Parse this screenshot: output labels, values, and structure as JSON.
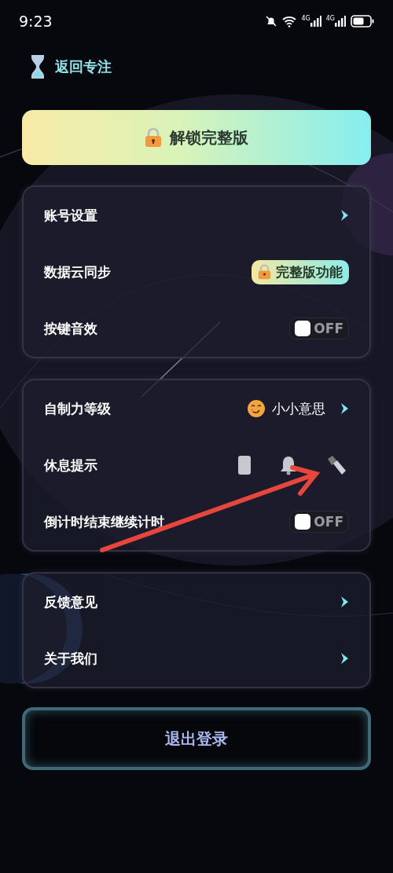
{
  "status_bar": {
    "time": "9:23",
    "networks": [
      "4G",
      "4G"
    ]
  },
  "header": {
    "back_label": "返回专注"
  },
  "unlock_button": {
    "label": "解锁完整版"
  },
  "groups": [
    {
      "rows": [
        {
          "kind": "link",
          "label": "账号设置"
        },
        {
          "kind": "badge",
          "label": "数据云同步",
          "badge": "完整版功能"
        },
        {
          "kind": "toggle",
          "label": "按键音效",
          "on": false,
          "state_text": "OFF"
        }
      ]
    },
    {
      "rows": [
        {
          "kind": "value",
          "label": "自制力等级",
          "value": "小小意思"
        },
        {
          "kind": "icons",
          "label": "休息提示"
        },
        {
          "kind": "toggle",
          "label": "倒计时结束继续计时",
          "on": false,
          "state_text": "OFF"
        }
      ]
    },
    {
      "rows": [
        {
          "kind": "link",
          "label": "反馈意见"
        },
        {
          "kind": "link",
          "label": "关于我们"
        }
      ]
    }
  ],
  "logout_button": {
    "label": "退出登录"
  }
}
